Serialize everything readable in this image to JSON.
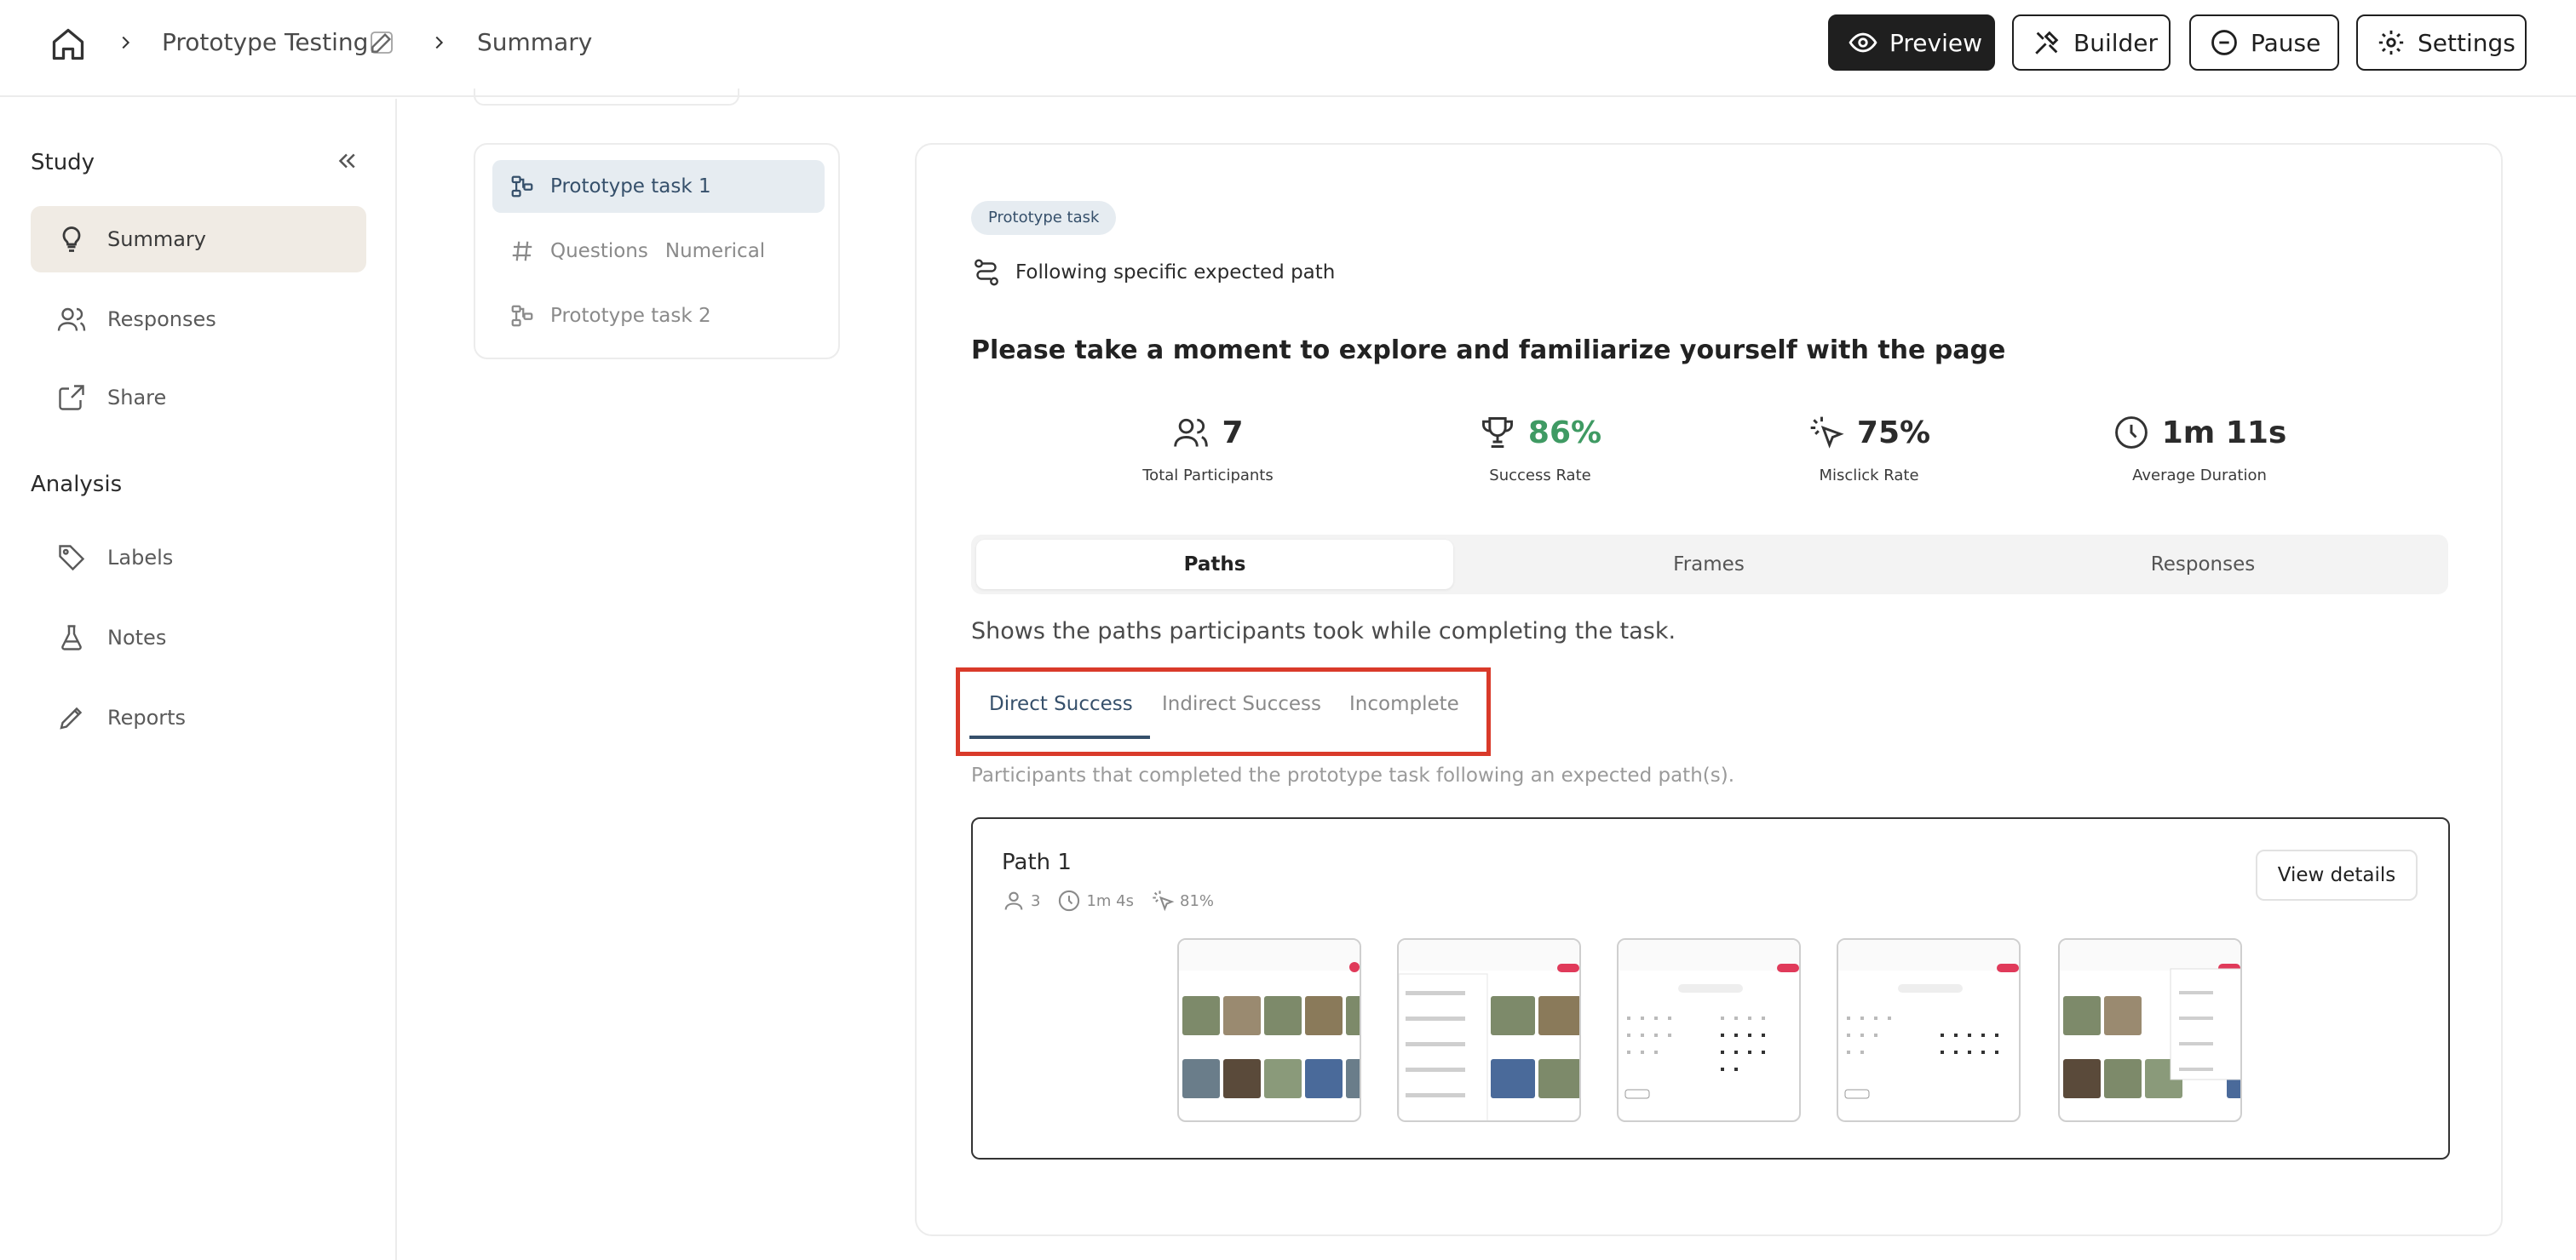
{
  "breadcrumb": {
    "project": "Prototype Testing",
    "page": "Summary"
  },
  "header_buttons": {
    "preview": "Preview",
    "builder": "Builder",
    "pause": "Pause",
    "settings": "Settings"
  },
  "sidebar": {
    "study_title": "Study",
    "study_items": [
      "Summary",
      "Responses",
      "Share"
    ],
    "analysis_title": "Analysis",
    "analysis_items": [
      "Labels",
      "Notes",
      "Reports"
    ]
  },
  "tasks": [
    {
      "label": "Prototype task 1",
      "sub": "",
      "icon": "prototype-icon"
    },
    {
      "label": "Questions",
      "sub": "Numerical",
      "icon": "hash-icon"
    },
    {
      "label": "Prototype task 2",
      "sub": "",
      "icon": "prototype-icon"
    }
  ],
  "main": {
    "badge": "Prototype task",
    "path_mode": "Following specific expected path",
    "question": "Please take a moment to explore and familiarize yourself with the page",
    "stats": {
      "participants": {
        "value": "7",
        "label": "Total Participants"
      },
      "success": {
        "value": "86%",
        "label": "Success Rate"
      },
      "misclick": {
        "value": "75%",
        "label": "Misclick Rate"
      },
      "duration": {
        "value": "1m 11s",
        "label": "Average Duration"
      }
    },
    "tabs": [
      "Paths",
      "Frames",
      "Responses"
    ],
    "tabs_description": "Shows the paths participants took while completing the task.",
    "subtabs": [
      "Direct Success",
      "Indirect Success",
      "Incomplete"
    ],
    "subtab_description": "Participants that completed the prototype task following an expected path(s).",
    "path": {
      "title": "Path 1",
      "participants": "3",
      "duration": "1m 4s",
      "misclick": "81%",
      "view_details": "View details"
    }
  },
  "colors": {
    "accent_blue": "#36506b",
    "success_green": "#3f9a63",
    "highlight_red": "#d93a2a",
    "active_nav_bg": "#f0ebe4"
  }
}
